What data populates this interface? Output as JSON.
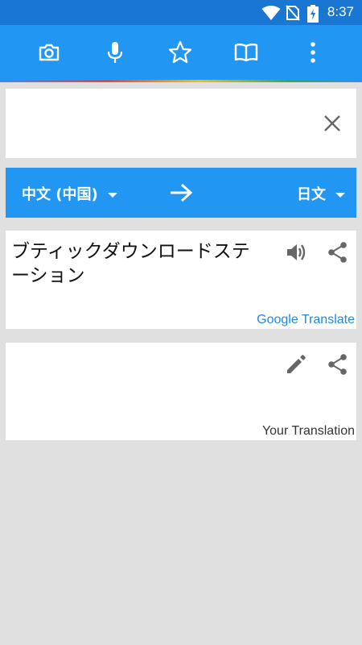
{
  "statusbar": {
    "time": "8:37",
    "icons": [
      "wifi-icon",
      "no-sim-icon",
      "battery-charging-icon"
    ]
  },
  "toolbar": {
    "icons": [
      "camera-icon",
      "microphone-icon",
      "star-icon",
      "book-icon",
      "more-vert-icon"
    ]
  },
  "input": {
    "text": ""
  },
  "languages": {
    "source": "中文 (中国)",
    "target": "日文"
  },
  "result": {
    "text": "ブティックダウンロードステーション",
    "credit": "Google Translate"
  },
  "user_translation": {
    "text": "",
    "credit": "Your Translation"
  },
  "colors": {
    "primary": "#2196f3",
    "status_bar": "#1976d2",
    "background": "#e0e0e0",
    "link": "#1e88e5"
  }
}
